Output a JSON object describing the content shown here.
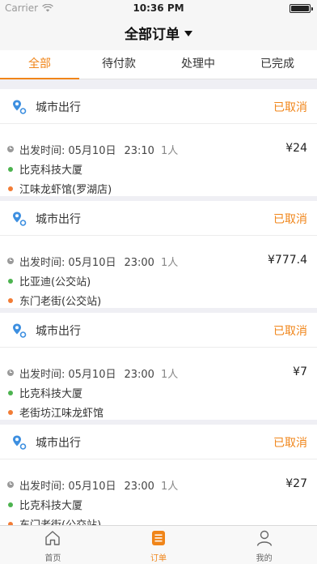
{
  "status_bar": {
    "carrier": "Carrier",
    "time": "10:36 PM"
  },
  "header": {
    "title": "全部订单"
  },
  "tabs": [
    {
      "label": "全部",
      "active": true
    },
    {
      "label": "待付款",
      "active": false
    },
    {
      "label": "处理中",
      "active": false
    },
    {
      "label": "已完成",
      "active": false
    }
  ],
  "orders": [
    {
      "type": "城市出行",
      "status": "已取消",
      "time_label": "出发时间:",
      "date": "05月10日",
      "clock": "23:10",
      "passengers": "1人",
      "price": "¥24",
      "from": "比克科技大厦",
      "to": "江味龙虾馆(罗湖店)"
    },
    {
      "type": "城市出行",
      "status": "已取消",
      "time_label": "出发时间:",
      "date": "05月10日",
      "clock": "23:00",
      "passengers": "1人",
      "price": "¥777.4",
      "from": "比亚迪(公交站)",
      "to": "东门老街(公交站)"
    },
    {
      "type": "城市出行",
      "status": "已取消",
      "time_label": "出发时间:",
      "date": "05月10日",
      "clock": "23:00",
      "passengers": "1人",
      "price": "¥7",
      "from": "比克科技大厦",
      "to": "老街坊江味龙虾馆"
    },
    {
      "type": "城市出行",
      "status": "已取消",
      "time_label": "出发时间:",
      "date": "05月10日",
      "clock": "23:00",
      "passengers": "1人",
      "price": "¥27",
      "from": "比克科技大厦",
      "to": "东门老街(公交站)"
    }
  ],
  "bottom_nav": [
    {
      "label": "首页",
      "icon": "home-icon",
      "active": false
    },
    {
      "label": "订单",
      "icon": "order-list-icon",
      "active": true
    },
    {
      "label": "我的",
      "icon": "profile-icon",
      "active": false
    }
  ],
  "colors": {
    "accent": "#f08519",
    "from_dot": "#4cb34f",
    "to_dot": "#f27c35",
    "pin": "#3d8fe0"
  }
}
